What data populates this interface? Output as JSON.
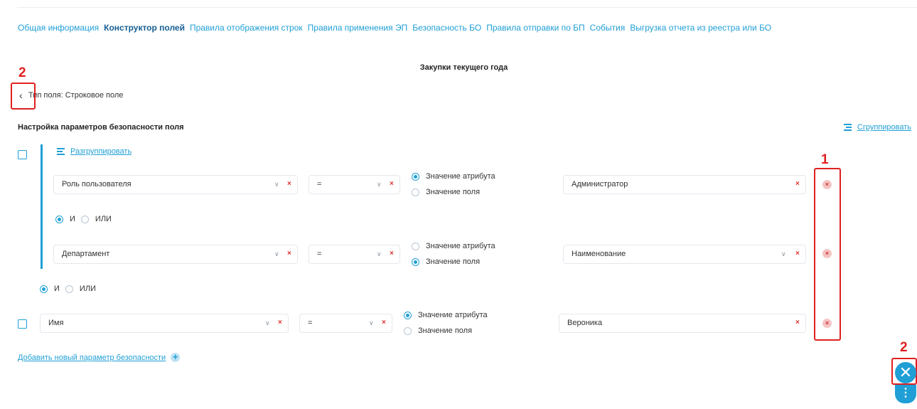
{
  "tabs": [
    {
      "label": "Общая информация"
    },
    {
      "label": "Конструктор полей"
    },
    {
      "label": "Правила отображения строк"
    },
    {
      "label": "Правила применения ЭП"
    },
    {
      "label": "Безопасность БО"
    },
    {
      "label": "Правила отправки по БП"
    },
    {
      "label": "События"
    },
    {
      "label": "Выгрузка отчета из реестра или БО"
    }
  ],
  "active_tab": "Конструктор полей",
  "page_title": "Закупки текущего года",
  "field_type": "Тип поля: Строковое поле",
  "section_title": "Настройка параметров безопасности поля",
  "group_link": "Сгруппировать",
  "ungroup_link": "Разгруппировать",
  "group": {
    "rows": [
      {
        "field": "Роль пользователя",
        "operator": "=",
        "value_type_options": [
          "Значение атрибута",
          "Значение поля"
        ],
        "value_type_selected": "Значение атрибута",
        "value": "Администратор"
      },
      {
        "field": "Департамент",
        "operator": "=",
        "value_type_options": [
          "Значение атрибута",
          "Значение поля"
        ],
        "value_type_selected": "Значение поля",
        "value": "Наименование"
      }
    ],
    "logic": {
      "options": [
        "И",
        "ИЛИ"
      ],
      "selected": "И"
    }
  },
  "outer_logic": {
    "options": [
      "И",
      "ИЛИ"
    ],
    "selected": "И"
  },
  "row3": {
    "field": "Имя",
    "operator": "=",
    "value_type_options": [
      "Значение атрибута",
      "Значение поля"
    ],
    "value_type_selected": "Значение атрибута",
    "value": "Вероника"
  },
  "add_param": "Добавить новый параметр безопасности",
  "annotations": {
    "marker_1": "1",
    "marker_2": "2"
  },
  "icons": {
    "clear": "×",
    "chevron": "∨",
    "back": "‹",
    "close": "✕",
    "more": "⋮",
    "plus": "+"
  },
  "colors": {
    "accent": "#1f9fd6",
    "annotation": "#e02020",
    "delete": "#f5c4c4"
  }
}
